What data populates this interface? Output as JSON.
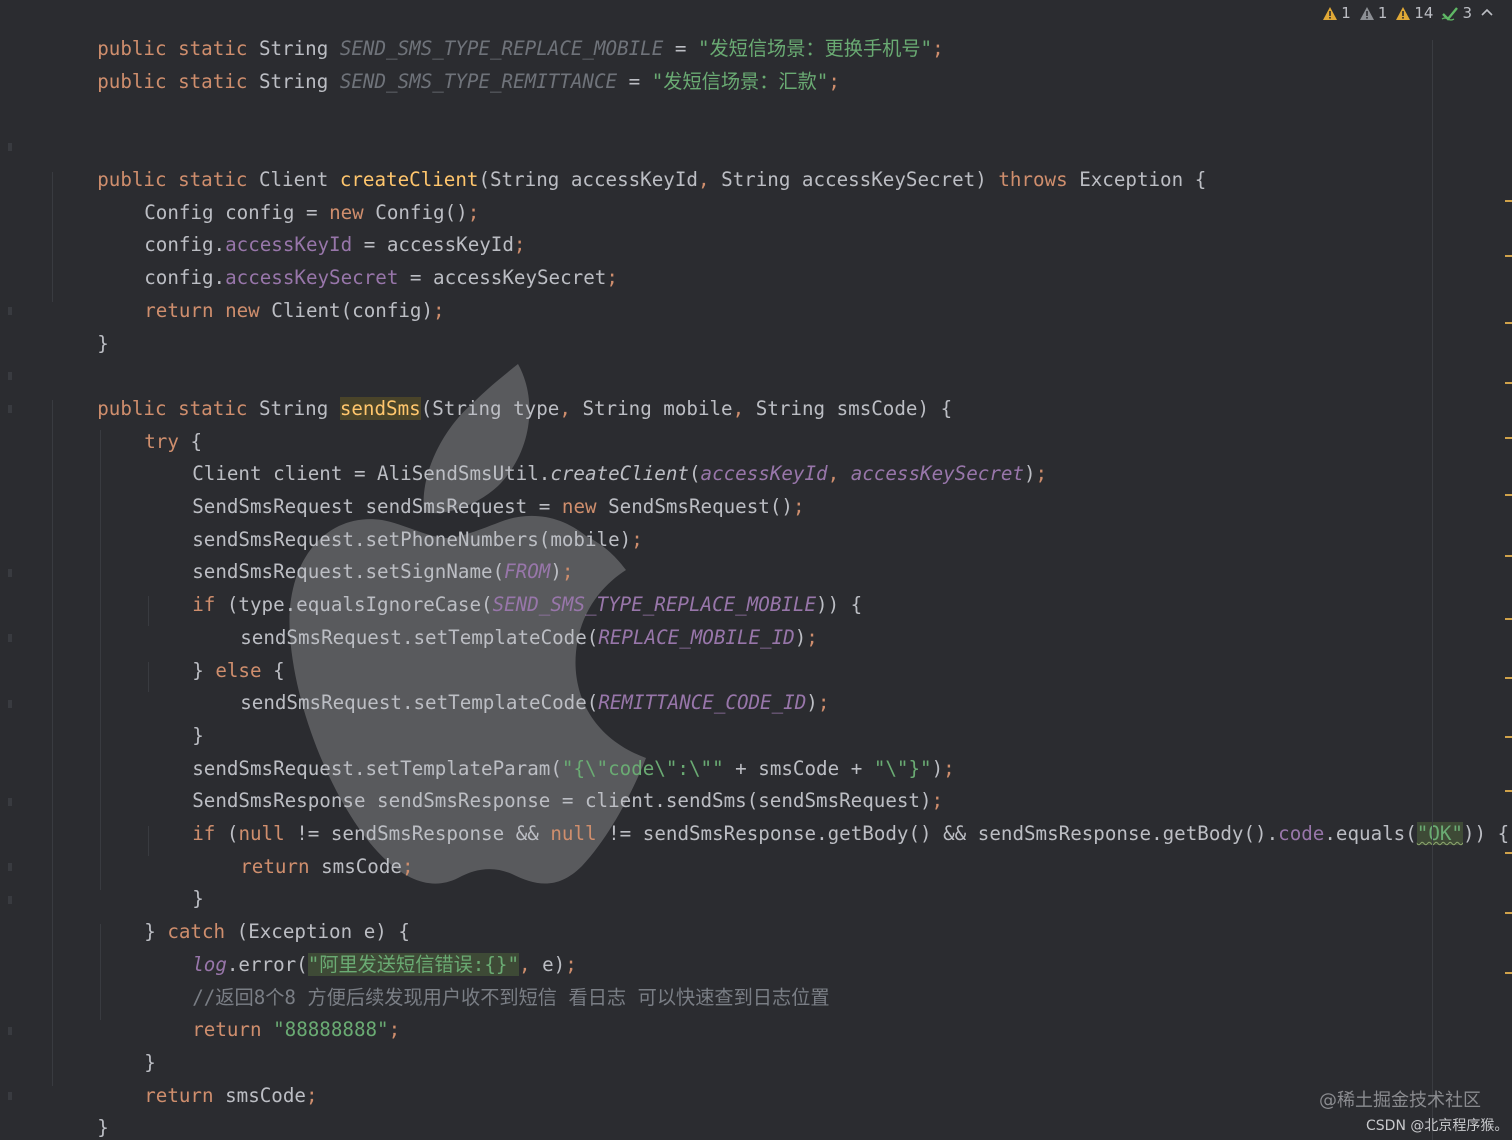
{
  "inspections": {
    "warning_a": "1",
    "warning_b": "1",
    "warning_c": "14",
    "checks": "3"
  },
  "code": {
    "l1": {
      "kw1": "public static ",
      "type": "String ",
      "name": "SEND_SMS_TYPE_REPLACE_MOBILE",
      "eq": " = ",
      "val": "\"发短信场景：更换手机号\"",
      "semi": ";"
    },
    "l2": {
      "kw1": "public static ",
      "type": "String ",
      "name": "SEND_SMS_TYPE_REMITTANCE",
      "eq": " = ",
      "val": "\"发短信场景：汇款\"",
      "semi": ";"
    },
    "l5": {
      "kw1": "public static ",
      "t1": "Client ",
      "fn": "createClient",
      "p1": "(String accessKeyId",
      "c1": ", ",
      "p2": "String accessKeySecret) ",
      "kw2": "throws ",
      "p3": "Exception {"
    },
    "l6": {
      "t1": "Config config = ",
      "kw": "new ",
      "t2": "Config()",
      "semi": ";"
    },
    "l7": {
      "t1": "config.",
      "fld": "accessKeyId",
      "t2": " = accessKeyId",
      "semi": ";"
    },
    "l8": {
      "t1": "config.",
      "fld": "accessKeySecret",
      "t2": " = accessKeySecret",
      "semi": ";"
    },
    "l9": {
      "kw": "return new ",
      "t1": "Client(config)",
      "semi": ";"
    },
    "l10": {
      "t1": "}"
    },
    "l12": {
      "kw1": "public static ",
      "t1": "String ",
      "fn": "sendSms",
      "p1": "(String type",
      "c1": ", ",
      "p2": "String mobile",
      "c2": ", ",
      "p3": "String smsCode) {"
    },
    "l13": {
      "kw": "try ",
      "t1": "{"
    },
    "l14": {
      "t1": "Client client = AliSendSmsUtil.",
      "sm": "createClient",
      "t2": "(",
      "a1": "accessKeyId",
      "c1": ", ",
      "a2": "accessKeySecret",
      "t3": ")",
      "semi": ";"
    },
    "l15": {
      "t1": "SendSmsRequest sendSmsRequest = ",
      "kw": "new ",
      "t2": "SendSmsRequest()",
      "semi": ";"
    },
    "l16": {
      "t1": "sendSmsRequest.setPhoneNumbers(mobile)",
      "semi": ";"
    },
    "l17": {
      "t1": "sendSmsRequest.setSignName(",
      "a1": "FROM",
      "t2": ")",
      "semi": ";"
    },
    "l18": {
      "kw": "if ",
      "t1": "(type.equalsIgnoreCase(",
      "a1": "SEND_SMS_TYPE_REPLACE_MOBILE",
      "t2": ")) {"
    },
    "l19": {
      "t1": "sendSmsRequest.setTemplateCode(",
      "a1": "REPLACE_MOBILE_ID",
      "t2": ")",
      "semi": ";"
    },
    "l20": {
      "t1": "} ",
      "kw": "else ",
      "t2": "{"
    },
    "l21": {
      "t1": "sendSmsRequest.setTemplateCode(",
      "a1": "REMITTANCE_CODE_ID",
      "t2": ")",
      "semi": ";"
    },
    "l22": {
      "t1": "}"
    },
    "l23": {
      "t1": "sendSmsRequest.setTemplateParam(",
      "s1": "\"{\\\"code\\\":\\\"\"",
      "t2": " + smsCode + ",
      "s2": "\"\\\"}\"",
      "t3": ")",
      "semi": ";"
    },
    "l24": {
      "t1": "SendSmsResponse sendSmsResponse = client.sendSms(sendSmsRequest)",
      "semi": ";"
    },
    "l25": {
      "kw1": "if ",
      "t1": "(",
      "kw2": "null",
      "t2": " != sendSmsResponse && ",
      "kw3": "null",
      "t3": " != sendSmsResponse.getBody() && sendSmsResponse.getBody().",
      "fld": "code",
      "t4": ".equals(",
      "s1": "\"OK\"",
      "t5": ")) {"
    },
    "l26": {
      "kw": "return ",
      "t1": "smsCode",
      "semi": ";"
    },
    "l27": {
      "t1": "}"
    },
    "l28": {
      "t1": "} ",
      "kw": "catch ",
      "t2": "(Exception e) {"
    },
    "l29": {
      "sm": "log",
      "t1": ".error(",
      "s1": "\"阿里发送短信错误:{}\"",
      "c1": ", ",
      "t2": "e)",
      "semi": ";"
    },
    "l30": {
      "cmt": "//返回8个8 方便后续发现用户收不到短信 看日志 可以快速查到日志位置"
    },
    "l31": {
      "kw": "return ",
      "s1": "\"88888888\"",
      "semi": ";"
    },
    "l32": {
      "t1": "}"
    },
    "l33": {
      "kw": "return ",
      "t1": "smsCode",
      "semi": ";"
    },
    "l34": {
      "t1": "}"
    },
    "l35": {
      "t1": "}"
    }
  },
  "watermarks": {
    "juejin": "@稀土掘金技术社区",
    "csdn": "CSDN @北京程序猴。"
  },
  "colors": {
    "background": "#2b2c30",
    "keyword": "#cf8e6d",
    "function": "#ffc66d",
    "string": "#6aab73",
    "field": "#9876aa",
    "comment": "#7a7e85",
    "text": "#bcbec4"
  }
}
